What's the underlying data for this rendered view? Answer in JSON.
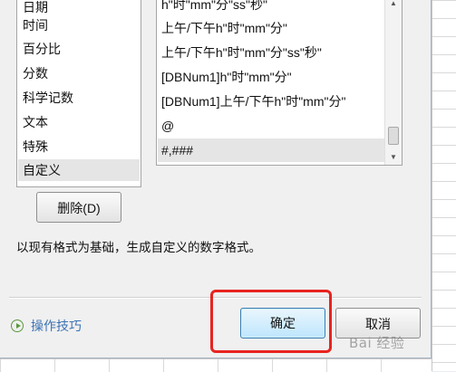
{
  "categories": {
    "items": [
      "日期",
      "时间",
      "百分比",
      "分数",
      "科学记数",
      "文本",
      "特殊",
      "自定义"
    ],
    "selected": "自定义"
  },
  "types": {
    "items": [
      "h\"时\"mm\"分\"ss\"秒\"",
      "上午/下午h\"时\"mm\"分\"",
      "上午/下午h\"时\"mm\"分\"ss\"秒\"",
      "[DBNum1]h\"时\"mm\"分\"",
      "[DBNum1]上午/下午h\"时\"mm\"分\"",
      "@",
      "#,###"
    ],
    "selected": "#,###"
  },
  "buttons": {
    "delete": "删除(D)",
    "ok": "确定",
    "cancel": "取消"
  },
  "description": "以现有格式为基础，生成自定义的数字格式。",
  "tips": {
    "label": "操作技巧",
    "icon": "play-circle-icon"
  },
  "scrollbar": {
    "up_icon": "▲",
    "down_icon": "▼"
  },
  "watermark": "Bai 经验",
  "colors": {
    "highlight": "#e8231f",
    "link": "#3c72b5",
    "ok_button_border": "#3c7fb1"
  }
}
